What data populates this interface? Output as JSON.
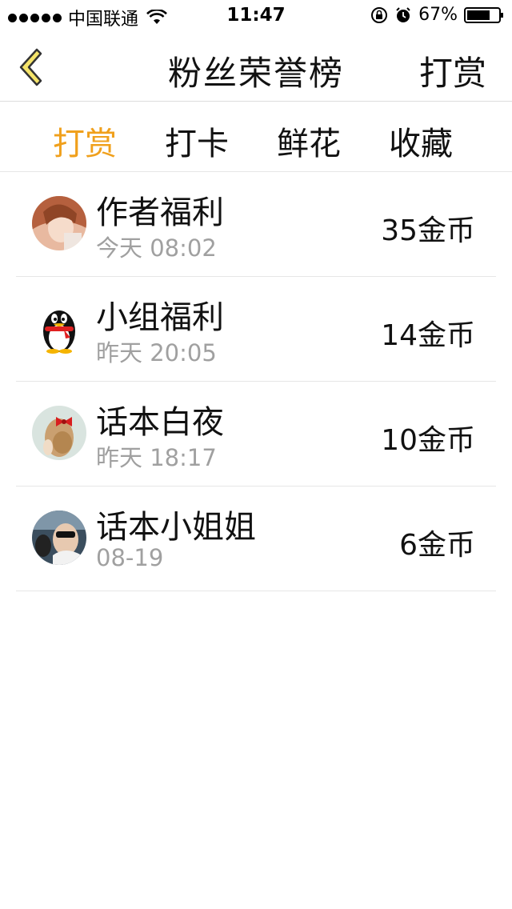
{
  "status_bar": {
    "carrier": "中国联通",
    "time": "11:47",
    "battery": "67%"
  },
  "nav": {
    "title": "粉丝荣誉榜",
    "action": "打赏"
  },
  "tabs": [
    {
      "label": "打赏",
      "active": true
    },
    {
      "label": "打卡",
      "active": false
    },
    {
      "label": "鲜花",
      "active": false
    },
    {
      "label": "收藏",
      "active": false
    }
  ],
  "list": [
    {
      "name": "作者福利",
      "time": "今天 08:02",
      "amount": "35金币",
      "avatar": "anime-girl-avatar"
    },
    {
      "name": "小组福利",
      "time": "昨天 20:05",
      "amount": "14金币",
      "avatar": "penguin-avatar"
    },
    {
      "name": "话本白夜",
      "time": "昨天 18:17",
      "amount": "10金币",
      "avatar": "girl-bow-avatar"
    },
    {
      "name": "话本小姐姐",
      "time": "08-19",
      "amount": "6金币",
      "avatar": "sunglasses-avatar"
    }
  ],
  "colors": {
    "accent": "#f0a01c",
    "back_arrow_fill": "#f5e46a",
    "divider": "#e6e6e6",
    "secondary_text": "#a0a0a0"
  }
}
